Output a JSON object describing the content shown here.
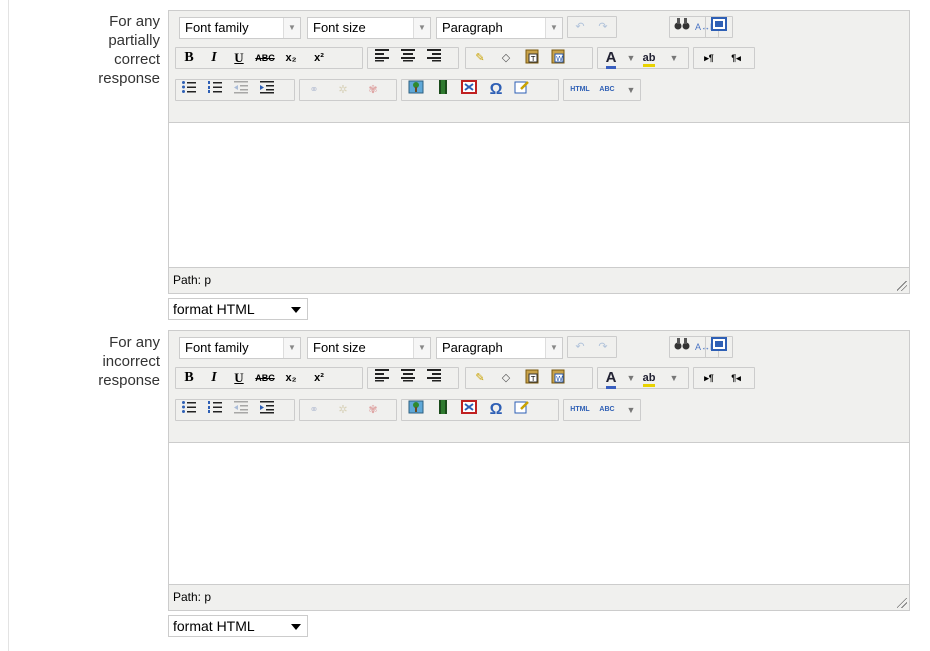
{
  "fields": [
    {
      "label": "For any partially correct response",
      "label_lines": [
        "For any",
        "partially",
        "correct",
        "response"
      ],
      "toolbar": {
        "font_family": "Font family",
        "font_size": "Font size",
        "block_format": "Paragraph"
      },
      "status_path": "Path: p",
      "format_value": "format HTML"
    },
    {
      "label": "For any incorrect response",
      "label_lines": [
        "For any",
        "incorrect",
        "response"
      ],
      "toolbar": {
        "font_family": "Font family",
        "font_size": "Font size",
        "block_format": "Paragraph"
      },
      "status_path": "Path: p",
      "format_value": "format HTML"
    }
  ],
  "toolbar_icons": {
    "row1": [
      "undo-icon",
      "redo-icon",
      "find-icon",
      "replace-icon",
      "fullscreen-icon"
    ],
    "row2": [
      "bold-icon",
      "italic-icon",
      "underline-icon",
      "strikethrough-icon",
      "subscript-icon",
      "superscript-icon",
      "align-left-icon",
      "align-center-icon",
      "align-right-icon",
      "cleanup-icon",
      "remove-format-icon",
      "paste-text-icon",
      "paste-word-icon",
      "text-color-icon",
      "background-color-icon",
      "ltr-icon",
      "rtl-icon"
    ],
    "row3": [
      "bullet-list-icon",
      "numbered-list-icon",
      "outdent-icon",
      "indent-icon",
      "link-icon",
      "unlink-icon",
      "anchor-icon",
      "image-icon",
      "media-icon",
      "no-autolink-icon",
      "special-char-icon",
      "edit-icon",
      "html-source-icon",
      "spellcheck-icon"
    ]
  },
  "glyphs": {
    "bold": "B",
    "italic": "I",
    "underline": "U",
    "strike": "ABC",
    "sub": "x₂",
    "sup": "x²",
    "omega": "Ω",
    "html": "HTML",
    "abc": "ABC",
    "ab": "ab",
    "ltr": "▸¶",
    "rtl": "¶◂",
    "text_color": "A"
  },
  "colors": {
    "editor_bg": "#f0f0ee",
    "border": "#cccccc"
  }
}
